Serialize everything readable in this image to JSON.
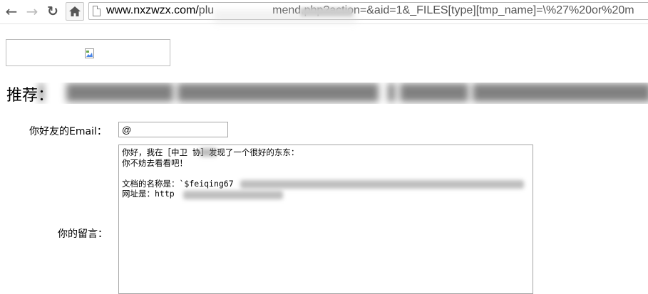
{
  "browser": {
    "url_host": "www.nxzwzx.com/",
    "url_path_visible": "plu",
    "url_rest": "mend.php?action=&aid=1&_FILES[type][tmp_name]=\\%27%20or%20m"
  },
  "heading": {
    "label": "推荐：",
    "text_redacted": "[feiqing67] ... [admin] ..."
  },
  "form": {
    "email_label": "你好友的Email：",
    "email_value": "@",
    "message_label": "你的留言：",
    "message_lines": [
      "你好，我在［中卫   协］发现了一个很好的东东：",
      "你不妨去看看吧！",
      "",
      "文档的名称是：`$feiqing67",
      "网址是：http"
    ]
  },
  "colors": {
    "border": "#a5a5a5",
    "disabled_nav": "#bbbbbb"
  },
  "icons": {
    "back": "back-arrow-icon",
    "forward": "forward-arrow-icon",
    "reload": "reload-icon",
    "home": "home-icon",
    "page": "page-icon",
    "broken_image": "broken-image-icon"
  }
}
